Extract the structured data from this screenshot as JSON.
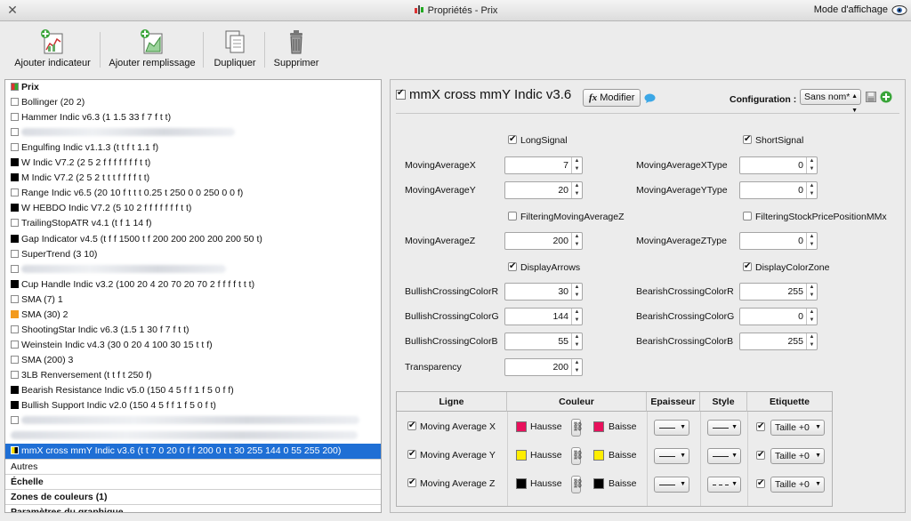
{
  "window": {
    "title": "Propriétés - Prix",
    "mode_label": "Mode d'affichage"
  },
  "toolbar": {
    "add_indicator": "Ajouter indicateur",
    "add_fill": "Ajouter remplissage",
    "duplicate": "Dupliquer",
    "delete": "Supprimer"
  },
  "tree": {
    "items": [
      {
        "label": "Prix",
        "box": "prix",
        "bold": true
      },
      {
        "label": "Bollinger (20 2)",
        "box": "empty"
      },
      {
        "label": "Hammer Indic v6.3 (1 1.5 33 f 7 f t t)",
        "box": "empty"
      },
      {
        "label": "",
        "box": "empty",
        "blurred": 240
      },
      {
        "label": "Engulfing Indic v1.1.3 (t t f t 1.1 f)",
        "box": "empty"
      },
      {
        "label": "W Indic V7.2 (2 5 2 f f f f f f f t t)",
        "box": "black"
      },
      {
        "label": "M Indic V7.2 (2 5 2 t t t f f f f t t)",
        "box": "black"
      },
      {
        "label": "Range Indic v6.5 (20 10 f t t t 0.25 t 250 0 0 250 0 0 f)",
        "box": "empty"
      },
      {
        "label": "W HEBDO Indic V7.2 (5 10 2 f f f f f f f t t)",
        "box": "black"
      },
      {
        "label": "TrailingStopATR v4.1 (t f 1 14 f)",
        "box": "empty"
      },
      {
        "label": "Gap Indicator v4.5 (t f f 1500 t f 200 200 200 200 200 50 t)",
        "box": "black"
      },
      {
        "label": "SuperTrend (3 10)",
        "box": "empty"
      },
      {
        "label": "",
        "box": "empty",
        "blurred": 230
      },
      {
        "label": "Cup Handle Indic v3.2 (100 20 4 20 70 20 70 2 f f f f t t t)",
        "box": "black"
      },
      {
        "label": "SMA (7) 1",
        "box": "empty"
      },
      {
        "label": "SMA (30) 2",
        "box": "orange"
      },
      {
        "label": "ShootingStar Indic v6.3 (1.5 1 30 f 7 f t t)",
        "box": "empty"
      },
      {
        "label": "Weinstein Indic v4.3 (30 0 20 4 100 30 15 t t f)",
        "box": "empty"
      },
      {
        "label": "SMA (200) 3",
        "box": "empty"
      },
      {
        "label": "3LB Renversement (t t f t 250 f)",
        "box": "empty"
      },
      {
        "label": "Bearish Resistance Indic v5.0 (150 4 5 f f 1 f 5 0 f f)",
        "box": "black"
      },
      {
        "label": "Bullish Support Indic v2.0 (150 4 5 f f 1 f 5 0 f t)",
        "box": "black"
      },
      {
        "label": "",
        "box": "empty",
        "blurred": 380
      },
      {
        "label": "",
        "box": "none",
        "blurred": 390
      },
      {
        "label": "mmX cross mmY Indic v3.6 (t t 7 0 20 0 f f 200 0 t t 30 255 144 0 55 255 200)",
        "box": "sel",
        "selected": true
      }
    ],
    "sections": [
      {
        "label": "Autres",
        "bold": false
      },
      {
        "label": "Échelle",
        "bold": true
      },
      {
        "label": "Zones de couleurs (1)",
        "bold": true
      },
      {
        "label": "Paramètres du graphique",
        "bold": true
      }
    ]
  },
  "panel": {
    "title": "mmX cross mmY Indic v3.6",
    "modify_label": "Modifier",
    "fx_label": "fx",
    "config_label": "Configuration :",
    "config_value": "Sans nom*",
    "params": {
      "long_signal": "LongSignal",
      "short_signal": "ShortSignal",
      "ma_x_label": "MovingAverageX",
      "ma_x": "7",
      "ma_x_type_label": "MovingAverageXType",
      "ma_x_type": "0",
      "ma_y_label": "MovingAverageY",
      "ma_y": "20",
      "ma_y_type_label": "MovingAverageYType",
      "ma_y_type": "0",
      "filter_ma_z": "FilteringMovingAverageZ",
      "filter_stock": "FilteringStockPricePositionMMx",
      "ma_z_label": "MovingAverageZ",
      "ma_z": "200",
      "ma_z_type_label": "MovingAverageZType",
      "ma_z_type": "0",
      "display_arrows": "DisplayArrows",
      "display_color_zone": "DisplayColorZone",
      "bull_r_label": "BullishCrossingColorR",
      "bull_r": "30",
      "bear_r_label": "BearishCrossingColorR",
      "bear_r": "255",
      "bull_g_label": "BullishCrossingColorG",
      "bull_g": "144",
      "bear_g_label": "BearishCrossingColorG",
      "bear_g": "0",
      "bull_b_label": "BullishCrossingColorB",
      "bull_b": "55",
      "bear_b_label": "BearishCrossingColorB",
      "bear_b": "255",
      "transparency_label": "Transparency",
      "transparency": "200"
    },
    "table": {
      "headers": [
        "Ligne",
        "Couleur",
        "Epaisseur",
        "Style",
        "Etiquette"
      ],
      "rows": [
        {
          "name": "Moving Average X",
          "up": "Hausse",
          "down": "Baisse",
          "up_color": "#e8115c",
          "down_color": "#e8115c",
          "style": "solid",
          "label": "Taille +0"
        },
        {
          "name": "Moving Average Y",
          "up": "Hausse",
          "down": "Baisse",
          "up_color": "#ffee00",
          "down_color": "#ffee00",
          "style": "solid",
          "label": "Taille +0"
        },
        {
          "name": "Moving Average Z",
          "up": "Hausse",
          "down": "Baisse",
          "up_color": "#000000",
          "down_color": "#000000",
          "style": "dashed",
          "label": "Taille +0"
        }
      ]
    }
  },
  "colors": {
    "selection": "#1f6fd5",
    "add_button": "#3aa53a"
  }
}
